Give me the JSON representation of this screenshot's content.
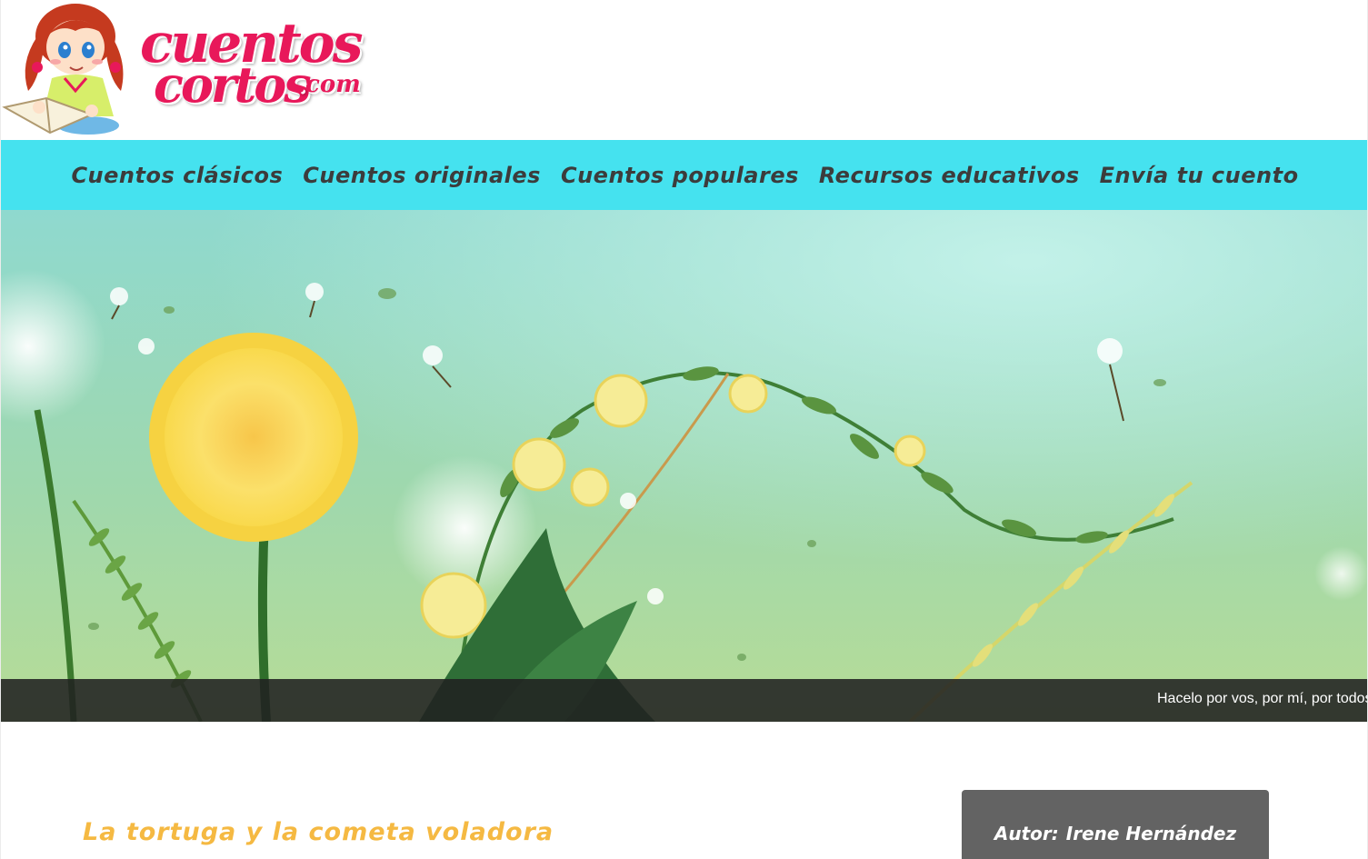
{
  "logo": {
    "word1": "cuentos",
    "word2": "cortos",
    "word3": ".com",
    "alt": "cuentoscortos.com"
  },
  "nav": {
    "items": [
      {
        "label": "Cuentos clásicos"
      },
      {
        "label": "Cuentos originales"
      },
      {
        "label": "Cuentos populares"
      },
      {
        "label": "Recursos educativos"
      },
      {
        "label": "Envía tu cuento"
      }
    ]
  },
  "ticker": {
    "text": "Hacelo por vos, por mí, por todos"
  },
  "story": {
    "title": "La tortuga y la cometa voladora"
  },
  "author": {
    "prefix": "Autor:",
    "name": "Irene Hernández"
  },
  "colors": {
    "nav_bg": "#45e2ef",
    "nav_text": "#3c3c3c",
    "logo_pink": "#e8185a",
    "title_orange": "#f5b942",
    "author_box": "#636363"
  }
}
